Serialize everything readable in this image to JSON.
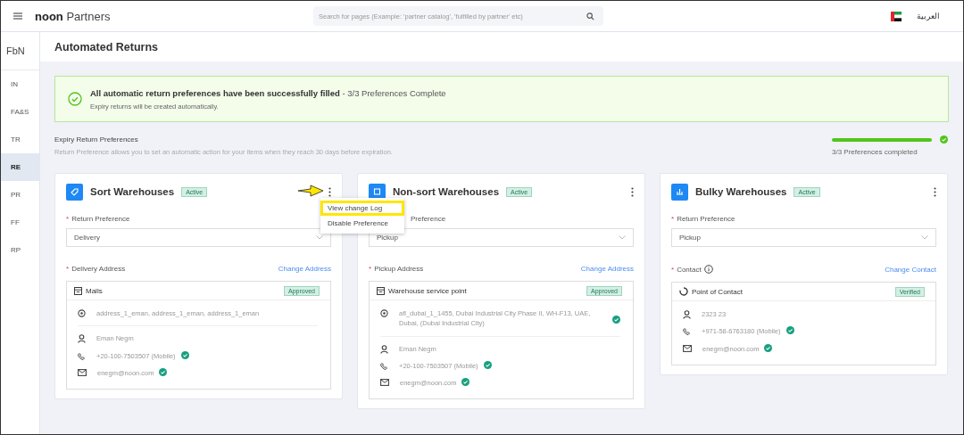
{
  "topbar": {
    "brand_bold": "noon",
    "brand": "Partners",
    "search": {
      "placeholder": "Search for pages (Example: 'partner catalog', 'fulfilled by partner' etc)"
    },
    "language": "العربية"
  },
  "sidebar": {
    "title": "FbN",
    "items": [
      {
        "label": "IN",
        "selected": false
      },
      {
        "label": "FA&S",
        "selected": false
      },
      {
        "label": "TR",
        "selected": false
      },
      {
        "label": "RE",
        "selected": true
      },
      {
        "label": "PR",
        "selected": false
      },
      {
        "label": "FF",
        "selected": false
      },
      {
        "label": "RP",
        "selected": false
      }
    ]
  },
  "page_title": "Automated Returns",
  "banner": {
    "title": "All automatic return preferences have been successfully filled",
    "suffix": " - 3/3 Preferences Complete",
    "subtitle": "Expiry returns will be created automatically."
  },
  "section": {
    "title": "Expiry Return Preferences",
    "description": "Return Preference allows you to set an automatic action for your items when they reach 30 days before expiration.",
    "progress": {
      "level": 1,
      "label": "3/3 Preferences completed"
    }
  },
  "cards": [
    {
      "title": "Sort Warehouses",
      "status": "Active",
      "preference_required_mark": "*",
      "preference_label": "Return Preference",
      "preference_value": "Delivery",
      "address_required_mark": "*",
      "address_label": "Delivery Address",
      "info": false,
      "action": "Change Address",
      "location": {
        "name": "Malls",
        "badge": "Approved",
        "address": {
          "text": "address_1_eman, address_1_eman, address_1_eman",
          "verified": false
        },
        "contact_name": "Eman Negm",
        "phone": "+20-100-7503507 (Mobile)",
        "phone_verified": true,
        "email": "enegm@noon.com",
        "email_verified": true
      }
    },
    {
      "title": "Non-sort Warehouses",
      "status": "Active",
      "preference_label": "Preference",
      "preference_value": "Pickup",
      "address_required_mark": "*",
      "address_label": "Pickup Address",
      "info": false,
      "action": "Change Address",
      "location": {
        "name": "Warehouse service point",
        "badge": "Approved",
        "address": {
          "text": "afl_dubai_1_1455, Dubai Industrial City Phase II, WH-F13, UAE, Dubai, (Dubai Industrial City)",
          "verified": true
        },
        "contact_name": "Eman Negm",
        "phone": "+20-100-7503507 (Mobile)",
        "phone_verified": true,
        "email": "enegm@noon.com",
        "email_verified": true
      }
    },
    {
      "title": "Bulky Warehouses",
      "status": "Active",
      "preference_required_mark": "*",
      "preference_label": "Return Preference",
      "preference_value": "Pickup",
      "address_required_mark": "*",
      "address_label": "Contact",
      "info": true,
      "action": "Change Contact",
      "location": {
        "name": "Point of Contact",
        "badge": "Verified",
        "contact_name": "2323 23",
        "phone": "+971-58-6763180 (Mobile)",
        "phone_verified": true,
        "email": "enegm@noon.com",
        "email_verified": true
      }
    }
  ],
  "menu": {
    "items": [
      {
        "label": "View change Log",
        "highlighted": true
      },
      {
        "label": "Disable Preference",
        "highlighted": false
      }
    ]
  }
}
